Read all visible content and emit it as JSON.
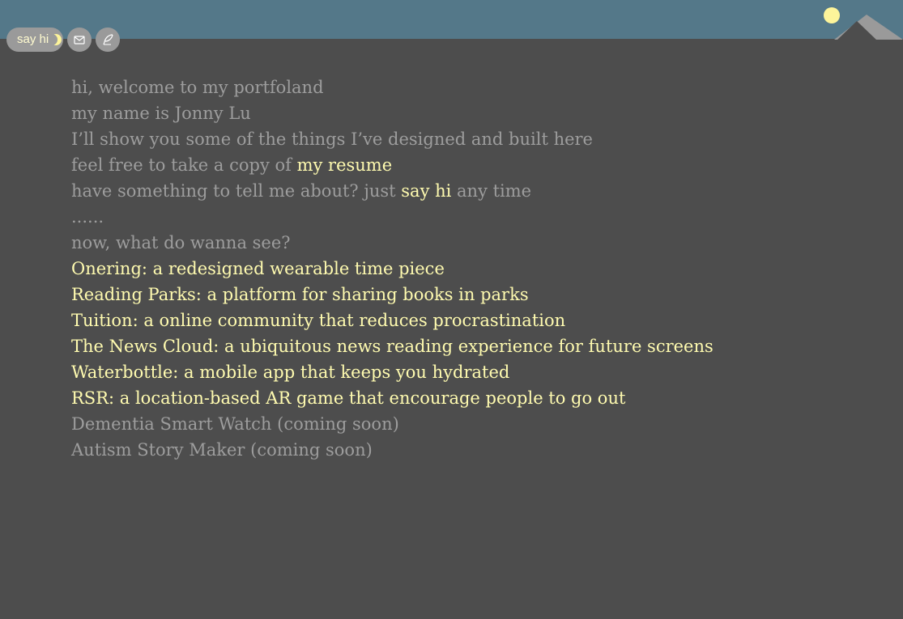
{
  "header": {
    "say_hi_label": "say hi",
    "colors": {
      "bar": "#547889",
      "moon": "#fdf49a",
      "mountain_dark": "#4d4d4d",
      "mountain_light": "#9a9a9a"
    }
  },
  "toolbar": {
    "email_icon": "envelope-icon",
    "blog_icon": "quill-icon"
  },
  "intro": {
    "line1": "hi, welcome to my portfoland",
    "line2": "my name is Jonny Lu",
    "line3": "I’ll show you some of the things I’ve designed and built here",
    "line4_prefix": "feel free to take a copy of ",
    "line4_link": "my resume",
    "line5_prefix": "have something to tell me about? just ",
    "line5_link": "say hi",
    "line5_suffix": " any time",
    "ellipsis": "......",
    "question": "now, what do wanna see?"
  },
  "projects": [
    {
      "label": "Onering: a redesigned wearable time piece"
    },
    {
      "label": "Reading Parks: a platform for sharing books in parks"
    },
    {
      "label": "Tuition: a online community that reduces procrastination"
    },
    {
      "label": "The News Cloud: a ubiquitous news reading experience for future screens"
    },
    {
      "label": "Waterbottle: a mobile app that keeps you hydrated"
    },
    {
      "label": "RSR: a location-based AR game that encourage people to go out"
    }
  ],
  "coming_soon": [
    {
      "label": "Dementia Smart Watch (coming soon)"
    },
    {
      "label": "Autism Story Maker (coming soon)"
    }
  ],
  "colors": {
    "background": "#4d4d4d",
    "muted_text": "#9d9d9d",
    "highlight_text": "#fffbb0"
  }
}
